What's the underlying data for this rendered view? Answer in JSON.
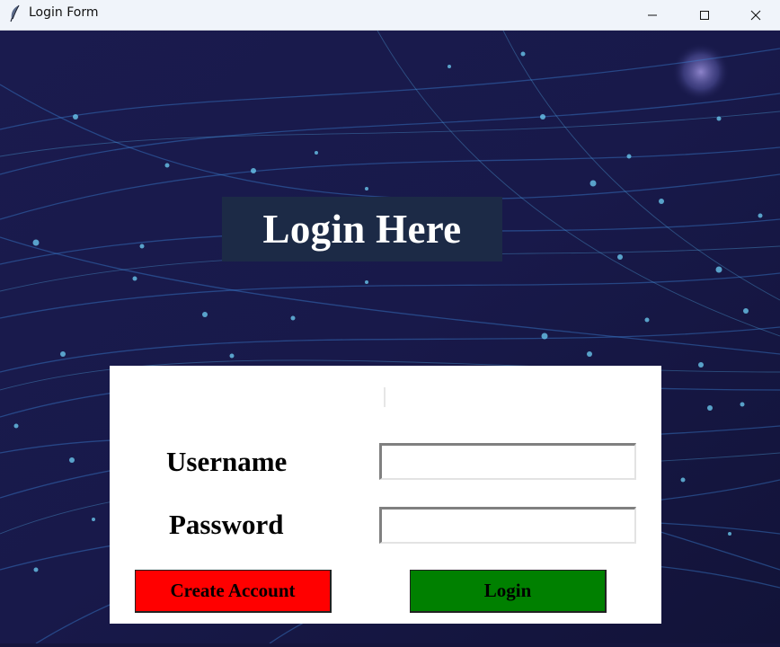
{
  "window": {
    "title": "Login Form",
    "icon": "feather-icon",
    "controls": [
      "minimize-icon",
      "maximize-icon",
      "close-icon"
    ]
  },
  "heading": {
    "text": "Login Here"
  },
  "form": {
    "username_label": "Username",
    "username_value": "",
    "password_label": "Password",
    "password_value": "",
    "create_account_label": "Create Account",
    "login_label": "Login"
  },
  "colors": {
    "background": "#14153d",
    "heading_box": "#1c2a46",
    "create_button": "#ff0000",
    "login_button": "#008000",
    "panel": "#ffffff"
  }
}
